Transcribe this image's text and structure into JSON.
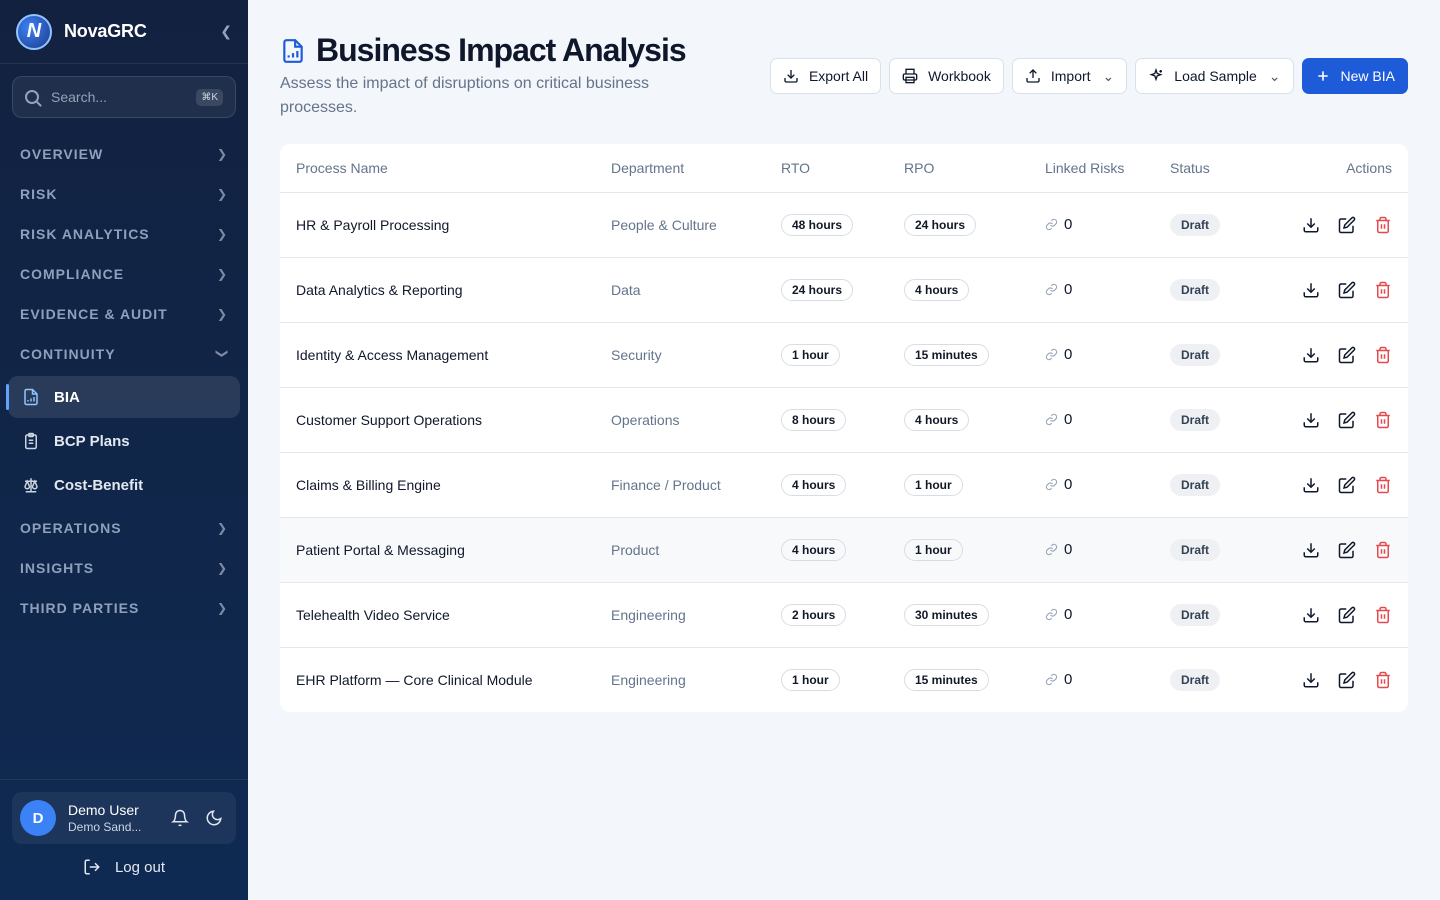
{
  "brand": {
    "name": "NovaGRC",
    "logo_letter": "N"
  },
  "search": {
    "placeholder": "Search...",
    "shortcut": "⌘K"
  },
  "nav": {
    "groups_top": [
      {
        "label": "OVERVIEW"
      },
      {
        "label": "RISK"
      },
      {
        "label": "RISK ANALYTICS"
      },
      {
        "label": "COMPLIANCE"
      },
      {
        "label": "EVIDENCE & AUDIT"
      },
      {
        "label": "CONTINUITY"
      }
    ],
    "continuity_items": [
      {
        "label": "BIA",
        "icon": "chart-document-icon"
      },
      {
        "label": "BCP Plans",
        "icon": "clipboard-list-icon"
      },
      {
        "label": "Cost-Benefit",
        "icon": "scale-icon"
      }
    ],
    "groups_bottom": [
      {
        "label": "OPERATIONS"
      },
      {
        "label": "INSIGHTS"
      },
      {
        "label": "THIRD PARTIES"
      }
    ]
  },
  "user": {
    "initial": "D",
    "name": "Demo User",
    "org": "Demo Sand...",
    "logout": "Log out"
  },
  "page": {
    "title": "Business Impact Analysis",
    "subtitle": "Assess the impact of disruptions on critical business processes."
  },
  "toolbar": {
    "export_all": "Export All",
    "workbook": "Workbook",
    "import": "Import",
    "load_sample": "Load Sample",
    "new_bia": "New BIA"
  },
  "table": {
    "headers": [
      "Process Name",
      "Department",
      "RTO",
      "RPO",
      "Linked Risks",
      "Status",
      "Actions"
    ],
    "rows": [
      {
        "process": "HR & Payroll Processing",
        "department": "People & Culture",
        "rto": "48 hours",
        "rpo": "24 hours",
        "linked": "0",
        "status": "Draft"
      },
      {
        "process": "Data Analytics & Reporting",
        "department": "Data",
        "rto": "24 hours",
        "rpo": "4 hours",
        "linked": "0",
        "status": "Draft"
      },
      {
        "process": "Identity & Access Management",
        "department": "Security",
        "rto": "1 hour",
        "rpo": "15 minutes",
        "linked": "0",
        "status": "Draft"
      },
      {
        "process": "Customer Support Operations",
        "department": "Operations",
        "rto": "8 hours",
        "rpo": "4 hours",
        "linked": "0",
        "status": "Draft"
      },
      {
        "process": "Claims & Billing Engine",
        "department": "Finance / Product",
        "rto": "4 hours",
        "rpo": "1 hour",
        "linked": "0",
        "status": "Draft"
      },
      {
        "process": "Patient Portal & Messaging",
        "department": "Product",
        "rto": "4 hours",
        "rpo": "1 hour",
        "linked": "0",
        "status": "Draft"
      },
      {
        "process": "Telehealth Video Service",
        "department": "Engineering",
        "rto": "2 hours",
        "rpo": "30 minutes",
        "linked": "0",
        "status": "Draft"
      },
      {
        "process": "EHR Platform — Core Clinical Module",
        "department": "Engineering",
        "rto": "1 hour",
        "rpo": "15 minutes",
        "linked": "0",
        "status": "Draft"
      }
    ]
  },
  "colors": {
    "primary": "#1d5bd8",
    "sidebar": "#12213f",
    "danger": "#e5484d"
  }
}
